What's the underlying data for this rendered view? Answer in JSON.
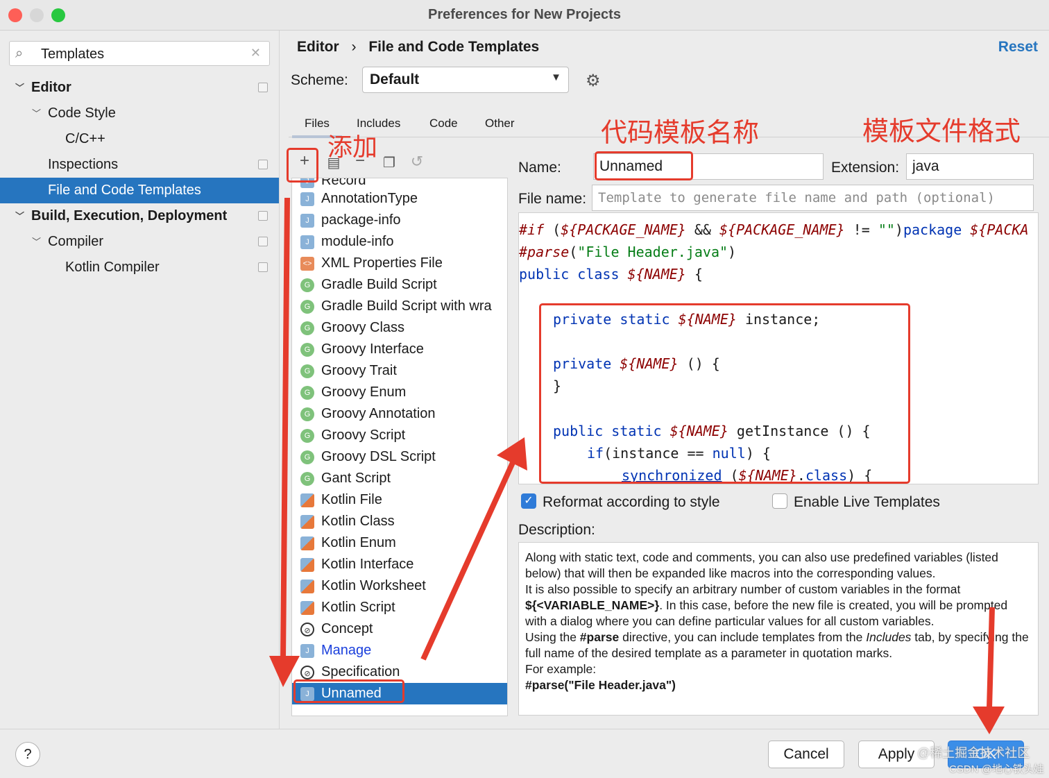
{
  "window": {
    "title": "Preferences for New Projects"
  },
  "sidebar": {
    "search_value": "Templates",
    "items": [
      {
        "label": "Editor"
      },
      {
        "label": "Code Style"
      },
      {
        "label": "C/C++"
      },
      {
        "label": "Inspections"
      },
      {
        "label": "File and Code Templates"
      },
      {
        "label": "Build, Execution, Deployment"
      },
      {
        "label": "Compiler"
      },
      {
        "label": "Kotlin Compiler"
      }
    ]
  },
  "header": {
    "crumb1": "Editor",
    "sep": "›",
    "crumb2": "File and Code Templates",
    "reset": "Reset"
  },
  "scheme": {
    "label": "Scheme:",
    "value": "Default"
  },
  "tabs": [
    {
      "label": "Files"
    },
    {
      "label": "Includes"
    },
    {
      "label": "Code"
    },
    {
      "label": "Other"
    }
  ],
  "templates": [
    {
      "label": "Record"
    },
    {
      "label": "AnnotationType"
    },
    {
      "label": "package-info"
    },
    {
      "label": "module-info"
    },
    {
      "label": "XML Properties File"
    },
    {
      "label": "Gradle Build Script"
    },
    {
      "label": "Gradle Build Script with wra"
    },
    {
      "label": "Groovy Class"
    },
    {
      "label": "Groovy Interface"
    },
    {
      "label": "Groovy Trait"
    },
    {
      "label": "Groovy Enum"
    },
    {
      "label": "Groovy Annotation"
    },
    {
      "label": "Groovy Script"
    },
    {
      "label": "Groovy DSL Script"
    },
    {
      "label": "Gant Script"
    },
    {
      "label": "Kotlin File"
    },
    {
      "label": "Kotlin Class"
    },
    {
      "label": "Kotlin Enum"
    },
    {
      "label": "Kotlin Interface"
    },
    {
      "label": "Kotlin Worksheet"
    },
    {
      "label": "Kotlin Script"
    },
    {
      "label": "Concept"
    },
    {
      "label": "Manage"
    },
    {
      "label": "Specification"
    },
    {
      "label": "Unnamed"
    }
  ],
  "form": {
    "name_label": "Name:",
    "name_value": "Unnamed",
    "ext_label": "Extension:",
    "ext_value": "java",
    "filename_label": "File name:",
    "filename_placeholder": "Template to generate file name and path (optional)"
  },
  "code": {
    "l1a": "#if",
    "l1b": " (",
    "l1c": "${PACKAGE_NAME}",
    "l1d": " && ",
    "l1e": "${PACKAGE_NAME}",
    "l1f": " != ",
    "l1g": "\"\"",
    "l1h": ")",
    "l1i": "package",
    "l1j": " ",
    "l1k": "${PACKA",
    "l2a": "#parse",
    "l2b": "(",
    "l2c": "\"File Header.java\"",
    "l2d": ")",
    "l3a": "public class",
    "l3b": " ",
    "l3c": "${NAME}",
    "l3d": " {",
    "l4a": "private static",
    "l4b": " ",
    "l4c": "${NAME}",
    "l4d": " instance;",
    "l5a": "private",
    "l5b": " ",
    "l5c": "${NAME}",
    "l5d": " () {",
    "l6": "}",
    "l7a": "public static",
    "l7b": " ",
    "l7c": "${NAME}",
    "l7d": " getInstance () {",
    "l8a": "if",
    "l8b": "(instance == ",
    "l8c": "null",
    "l8d": ") {",
    "l9a": "synchronized",
    "l9b": " (",
    "l9c": "${NAME}",
    "l9d": ".",
    "l9e": "class",
    "l9f": ") {"
  },
  "options": {
    "reformat": "Reformat according to style",
    "reformat_checked": true,
    "live": "Enable Live Templates",
    "live_checked": false
  },
  "description": {
    "label": "Description:",
    "p1": "Along with static text, code and comments, you can also use predefined variables (listed below) that will then be expanded like macros into the corresponding values.",
    "p2a": "It is also possible to specify an arbitrary number of custom variables in the format ",
    "p2b": "${<VARIABLE_NAME>}",
    "p2c": ". In this case, before the new file is created, you will be prompted with a dialog where you can define particular values for all custom variables.",
    "p3a": "Using the ",
    "p3b": "#parse",
    "p3c": " directive, you can include templates from the ",
    "p3d": "Includes",
    "p3e": " tab, by specifying the full name of the desired template as a parameter in quotation marks.",
    "p4": "For example:",
    "p5": "#parse(\"File Header.java\")"
  },
  "buttons": {
    "help": "?",
    "cancel": "Cancel",
    "apply": "Apply",
    "ok": "OK"
  },
  "annotations": {
    "add": "添加",
    "name": "代码模板名称",
    "format": "模板文件格式"
  },
  "watermark": {
    "line1": "@稀土掘金技术社区",
    "line2": "CSDN @地心铁头娃"
  },
  "colors": {
    "accent": "#2675bf",
    "annotation": "#e53b2c"
  }
}
